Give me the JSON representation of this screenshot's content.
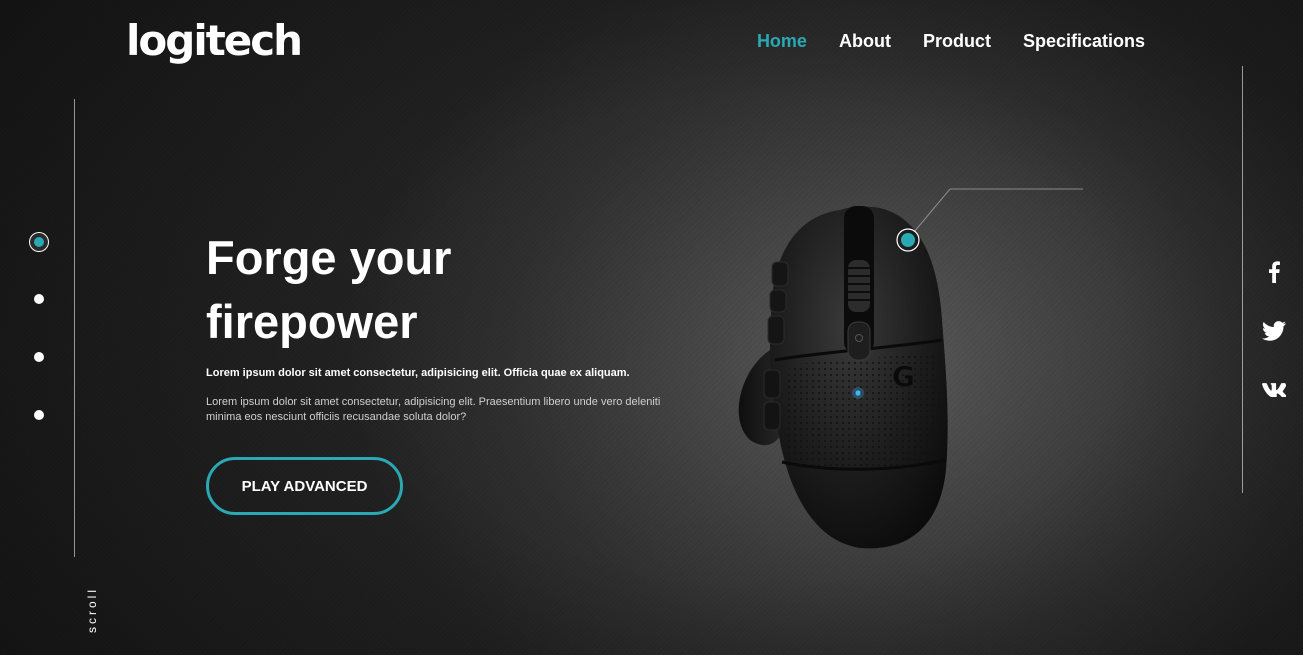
{
  "brand": {
    "logo_text": "logitech"
  },
  "nav": {
    "items": [
      {
        "label": "Home",
        "active": true
      },
      {
        "label": "About",
        "active": false
      },
      {
        "label": "Product",
        "active": false
      },
      {
        "label": "Specifications",
        "active": false
      }
    ]
  },
  "slider": {
    "dots": 4,
    "active_index": 0,
    "scroll_label": "scroll"
  },
  "hero": {
    "title_line1": "Forge your",
    "title_line2": "firepower",
    "lead": "Lorem ipsum dolor sit amet consectetur, adipisicing elit. Officia quae ex aliquam.",
    "body": "Lorem ipsum dolor sit amet consectetur, adipisicing elit. Praesentium libero unde vero deleniti minima eos nesciunt officiis recusandae soluta dolor?",
    "cta_label": "PLAY ADVANCED"
  },
  "social": {
    "icons": [
      "facebook-icon",
      "twitter-icon",
      "vk-icon"
    ]
  },
  "colors": {
    "accent": "#2aa9b4",
    "background": "#2e2e2e",
    "text": "#ffffff"
  }
}
